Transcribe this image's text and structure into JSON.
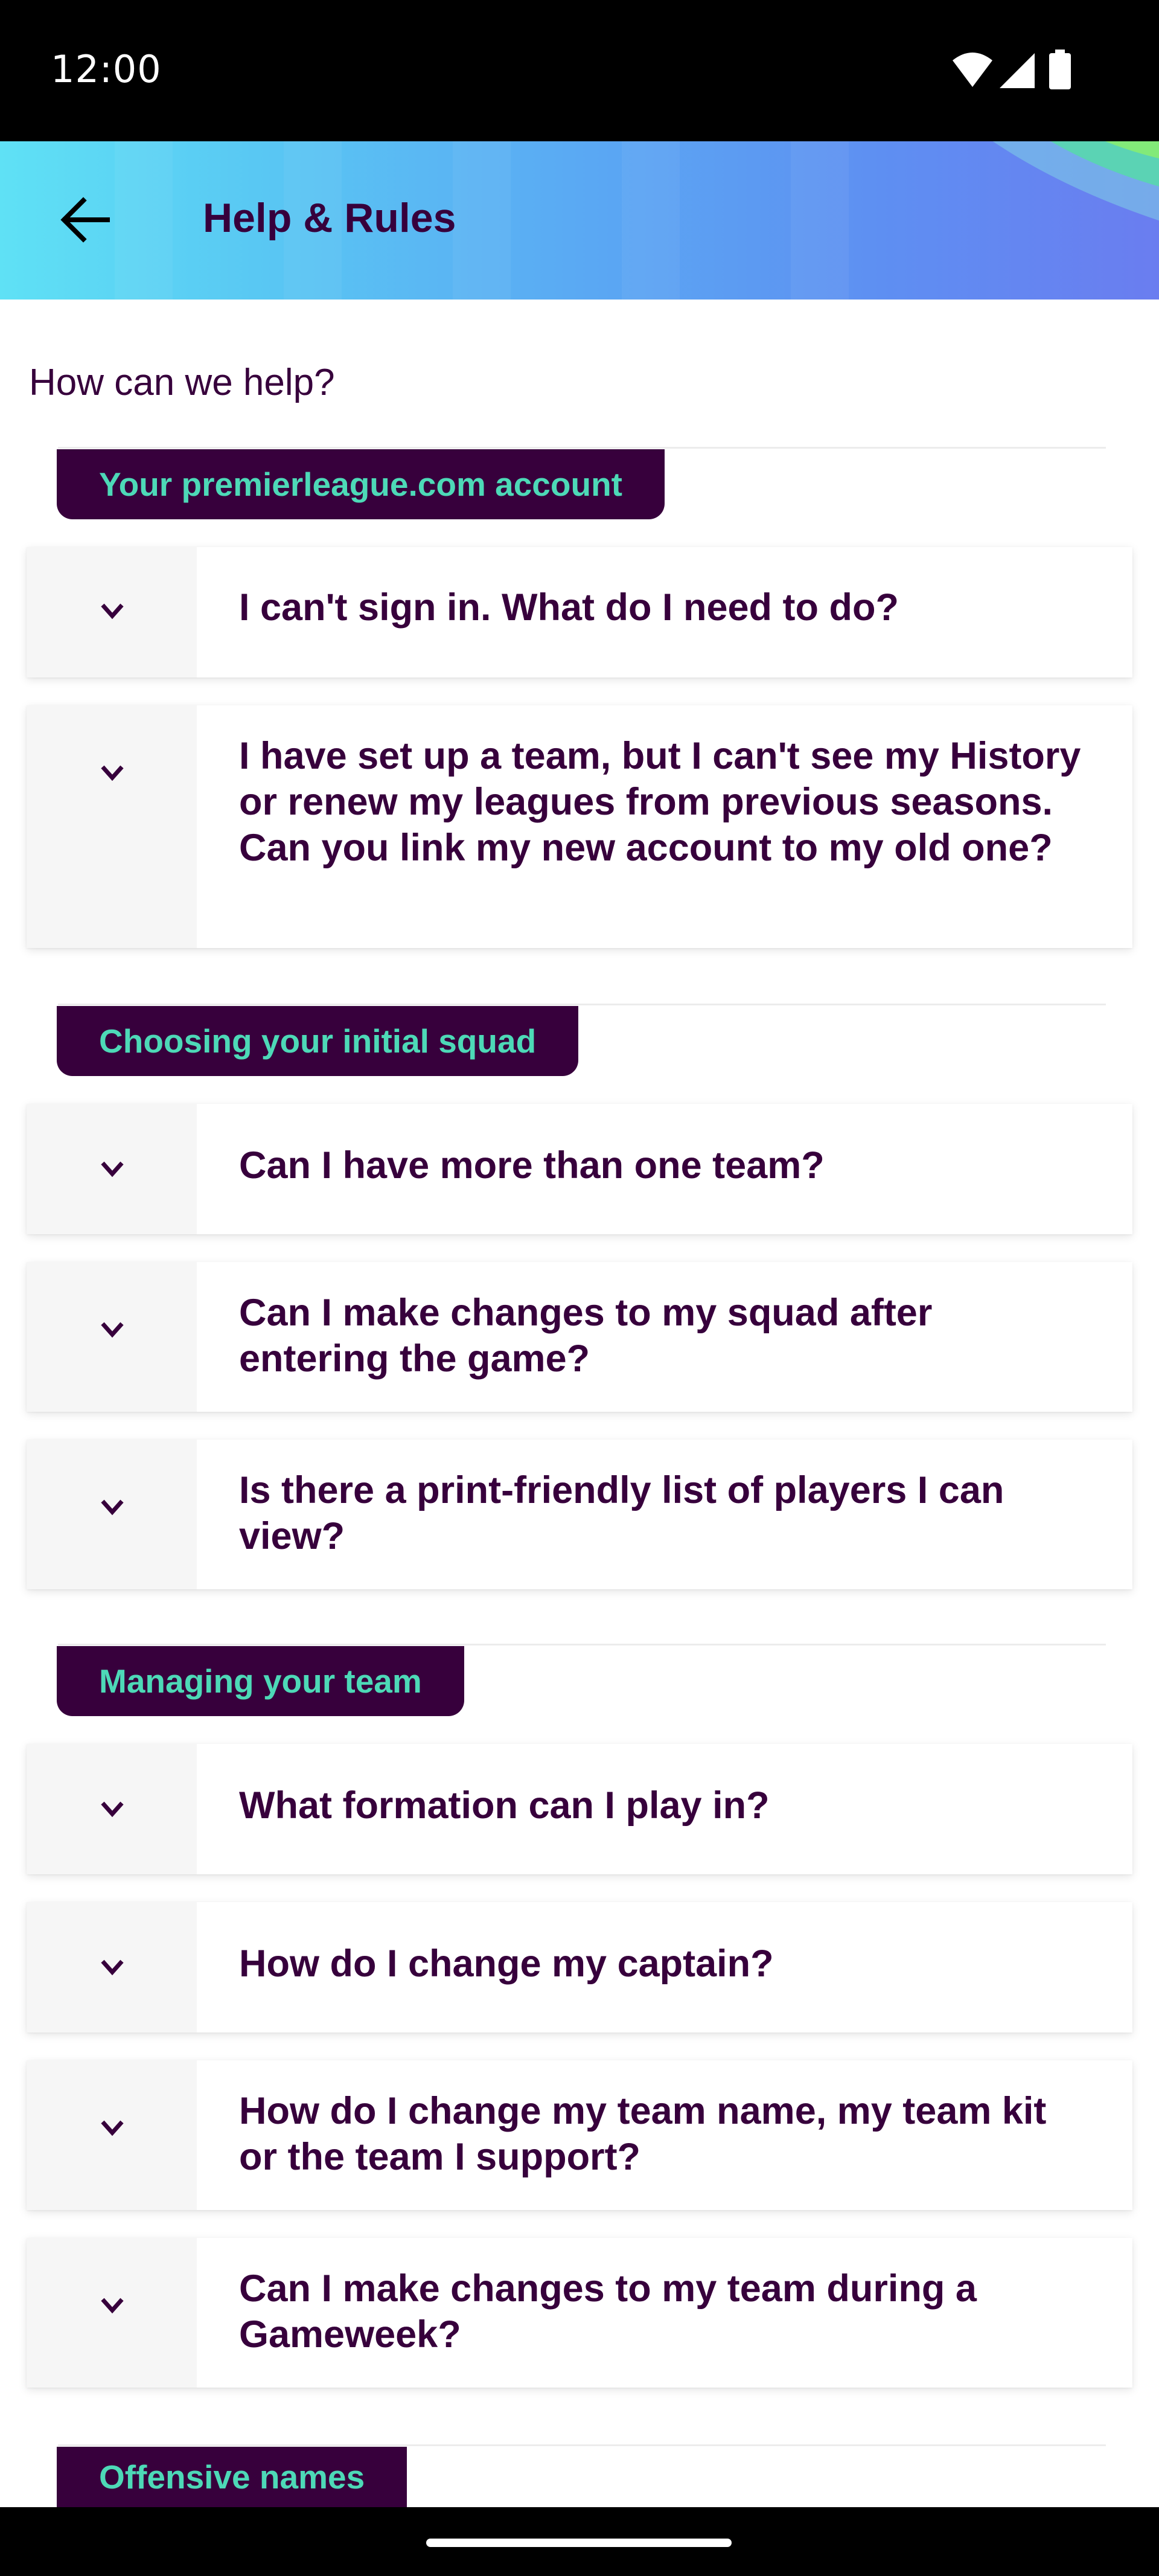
{
  "status_bar": {
    "time": "12:00",
    "icons": [
      "wifi-icon",
      "signal-icon",
      "battery-icon"
    ]
  },
  "app_bar": {
    "back_icon": "arrow-left-icon",
    "title": "Help & Rules"
  },
  "page": {
    "subtitle": "How can we help?"
  },
  "sections": [
    {
      "title": "Your premierleague.com account",
      "questions": [
        "I can't sign in. What do I need to do?",
        "I have set up a team, but I can't see my History or renew my leagues from previous seasons. Can you link my new account to my old one?"
      ]
    },
    {
      "title": "Choosing your initial squad",
      "questions": [
        "Can I have more than one team?",
        "Can I make changes to my squad after entering the game?",
        "Is there a print-friendly list of players I can view?"
      ]
    },
    {
      "title": "Managing your team",
      "questions": [
        "What formation can I play in?",
        "How do I change my captain?",
        "How do I change my team name, my team kit or the team I support?",
        "Can I make changes to my team during a Gameweek?"
      ]
    },
    {
      "title": "Offensive names",
      "questions": []
    }
  ],
  "colors": {
    "brand_purple": "#37003c",
    "brand_green": "#4dd9b7",
    "header_gradient_start": "#5fe1f5",
    "header_gradient_end": "#6a7df0"
  }
}
